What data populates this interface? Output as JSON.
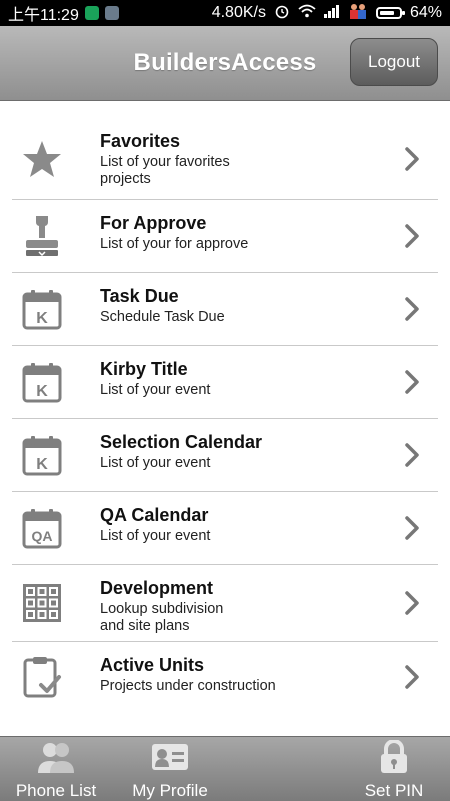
{
  "status_bar": {
    "time": "上午11:29",
    "network_speed": "4.80K/s",
    "battery": "64%"
  },
  "header": {
    "title": "BuildersAccess",
    "logout_label": "Logout"
  },
  "menu": {
    "items": [
      {
        "icon": "star-icon",
        "title": "Favorites",
        "subtitle": "List of your favorites\nprojects"
      },
      {
        "icon": "stamp-icon",
        "title": "For Approve",
        "subtitle": "List of your for approve"
      },
      {
        "icon": "calendar-k-icon",
        "title": "Task Due",
        "subtitle": "Schedule Task Due"
      },
      {
        "icon": "calendar-k-icon",
        "title": "Kirby Title",
        "subtitle": "List of your event"
      },
      {
        "icon": "calendar-k-icon",
        "title": "Selection Calendar",
        "subtitle": "List of your event"
      },
      {
        "icon": "calendar-qa-icon",
        "title": "QA Calendar",
        "subtitle": "List of your event"
      },
      {
        "icon": "grid-icon",
        "title": "Development",
        "subtitle": "Lookup subdivision\nand site plans"
      },
      {
        "icon": "clipboard-check-icon",
        "title": "Active Units",
        "subtitle": "Projects under construction"
      }
    ],
    "calendar_k_glyph": "K",
    "calendar_qa_glyph": "QA"
  },
  "tabbar": {
    "tabs": [
      {
        "icon": "people-icon",
        "label": "Phone List"
      },
      {
        "icon": "profile-card-icon",
        "label": "My Profile"
      },
      {
        "icon": "lock-icon",
        "label": "Set PIN"
      }
    ]
  },
  "colors": {
    "header_top": "#b9b9b9",
    "header_bottom": "#8f8f8f",
    "icon_gray": "#8a8a8a",
    "divider": "#c9c9c9"
  }
}
